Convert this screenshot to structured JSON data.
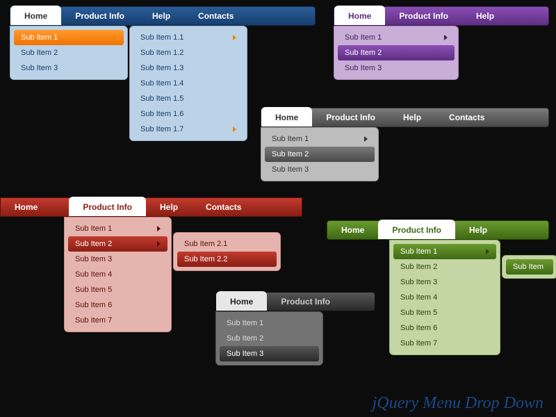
{
  "watermark": "jQuery Menu Drop Down",
  "blue": {
    "tabs": [
      "Home",
      "Product Info",
      "Help",
      "Contacts"
    ],
    "active": 0,
    "sub": [
      "Sub Item 1",
      "Sub Item 2",
      "Sub Item 3"
    ],
    "sub_hl": 0,
    "sub2": [
      "Sub Item 1.1",
      "Sub Item 1.2",
      "Sub Item 1.3",
      "Sub Item 1.4",
      "Sub Item 1.5",
      "Sub Item 1.6",
      "Sub Item 1.7"
    ]
  },
  "purple": {
    "tabs": [
      "Home",
      "Product Info",
      "Help"
    ],
    "active": 0,
    "sub": [
      "Sub Item 1",
      "Sub Item 2",
      "Sub Item 3"
    ],
    "sub_hl": 1
  },
  "gray": {
    "tabs": [
      "Home",
      "Product Info",
      "Help",
      "Contacts"
    ],
    "active": 0,
    "sub": [
      "Sub Item 1",
      "Sub Item 2",
      "Sub Item 3"
    ],
    "sub_hl": 1
  },
  "red": {
    "tabs": [
      "Home",
      "Product Info",
      "Help",
      "Contacts"
    ],
    "active": 1,
    "sub": [
      "Sub Item 1",
      "Sub Item 2",
      "Sub Item 3",
      "Sub Item 4",
      "Sub Item 5",
      "Sub Item 6",
      "Sub Item 7"
    ],
    "sub_hl": 1,
    "sub2": [
      "Sub Item 2.1",
      "Sub Item 2.2"
    ],
    "sub2_hl": 1
  },
  "dark": {
    "tabs": [
      "Home",
      "Product Info"
    ],
    "active": 0,
    "sub": [
      "Sub Item 1",
      "Sub Item 2",
      "Sub Item 3"
    ],
    "sub_hl": 2
  },
  "green": {
    "tabs": [
      "Home",
      "Product Info",
      "Help"
    ],
    "active": 1,
    "sub": [
      "Sub Item 1",
      "Sub Item 2",
      "Sub Item 3",
      "Sub Item 4",
      "Sub Item 5",
      "Sub Item 6",
      "Sub Item 7"
    ],
    "sub_hl": 0,
    "sub2": [
      "Sub Item"
    ]
  }
}
